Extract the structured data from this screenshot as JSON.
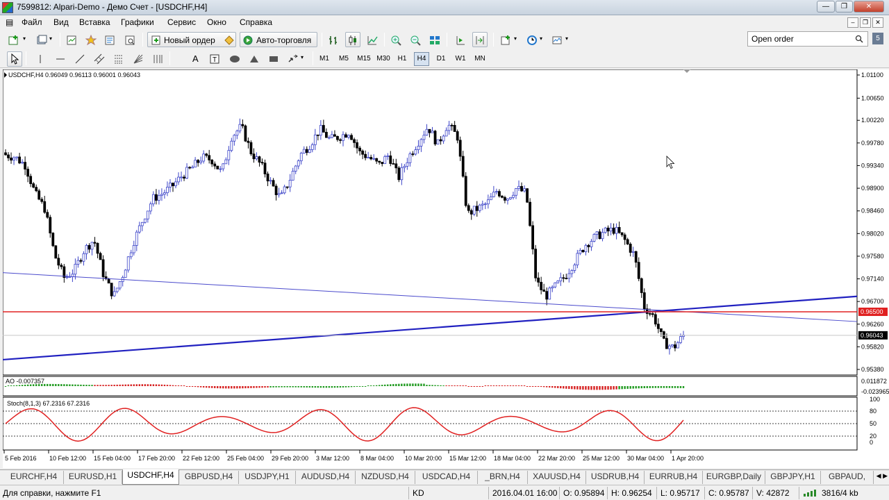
{
  "window": {
    "title": "7599812: Alpari-Demo - Демо Счет - [USDCHF,H4]",
    "min": "—",
    "max": "❐",
    "close": "✕"
  },
  "menu": [
    "Файл",
    "Вид",
    "Вставка",
    "Графики",
    "Сервис",
    "Окно",
    "Справка"
  ],
  "toolbar": {
    "new_order": "Новый ордер",
    "auto_trading": "Авто-торговля",
    "search_value": "Open order",
    "timeframes": [
      "M1",
      "M5",
      "M15",
      "M30",
      "H1",
      "H4",
      "D1",
      "W1",
      "MN"
    ],
    "active_timeframe": "H4"
  },
  "chart": {
    "symbol_info": "USDCHF,H4  0.96049 0.96113 0.96001 0.96043",
    "price_labels": [
      "1.01100",
      "1.00650",
      "1.00220",
      "0.99780",
      "0.99340",
      "0.98900",
      "0.98460",
      "0.98020",
      "0.97580",
      "0.97140",
      "0.96700",
      "0.96260",
      "0.95820",
      "0.95380"
    ],
    "level_red": "0.96500",
    "current_price": "0.96043",
    "ao_label": "AO -0.007357",
    "ao_scale_top": "0.011872",
    "ao_scale_bottom": "-0.023965",
    "stoch_label": "Stoch(8,1,3) 67.2316 67.2316",
    "stoch_levels": [
      "100",
      "80",
      "50",
      "20",
      "0"
    ],
    "time_labels": [
      "5 Feb 2016",
      "10 Feb 12:00",
      "15 Feb 04:00",
      "17 Feb 20:00",
      "22 Feb 12:00",
      "25 Feb 04:00",
      "29 Feb 20:00",
      "3 Mar 12:00",
      "8 Mar 04:00",
      "10 Mar 20:00",
      "15 Mar 12:00",
      "18 Mar 04:00",
      "22 Mar 20:00",
      "25 Mar 12:00",
      "30 Mar 04:00",
      "1 Apr 20:00"
    ],
    "colors": {
      "bull": "#3b43c8",
      "bear": "#000000",
      "resistance": "#e02020",
      "trend": "#2020c0",
      "stoch": "#e02020",
      "ao_up": "#1f9a1f",
      "ao_down": "#d62020"
    }
  },
  "chart_data": {
    "type": "candlestick",
    "symbol": "USDCHF",
    "timeframe": "H4",
    "ylim": [
      0.9538,
      1.011
    ],
    "close_series": [
      0.9955,
      0.995,
      0.9935,
      0.988,
      0.985,
      0.976,
      0.9715,
      0.973,
      0.977,
      0.979,
      0.972,
      0.968,
      0.9725,
      0.9785,
      0.983,
      0.987,
      0.988,
      0.9895,
      0.9915,
      0.993,
      0.995,
      0.9945,
      0.992,
      0.999,
      1.001,
      0.996,
      0.9935,
      0.99,
      0.987,
      0.991,
      0.9955,
      0.9975,
      1.0005,
      0.9985,
      0.999,
      1.0,
      0.996,
      0.995,
      0.9935,
      0.9955,
      0.991,
      0.995,
      0.998,
      1.001,
      0.9975,
      1.0015,
      0.999,
      0.984,
      0.985,
      0.986,
      0.9885,
      0.987,
      0.989,
      0.988,
      0.971,
      0.968,
      0.97,
      0.972,
      0.975,
      0.978,
      0.9795,
      0.9805,
      0.981,
      0.979,
      0.976,
      0.966,
      0.964,
      0.959,
      0.958,
      0.9604
    ],
    "levels": {
      "horizontal_red": 0.965,
      "current": 0.96043
    },
    "indicators": {
      "AO": {
        "value": -0.007357,
        "range": [
          -0.023965,
          0.011872
        ]
      },
      "Stoch": {
        "params": "8,1,3",
        "main": 67.2316,
        "signal": 67.2316,
        "levels": [
          20,
          50,
          80
        ]
      }
    }
  },
  "symbol_tabs": [
    "EURCHF,H4",
    "EURUSD,H1",
    "USDCHF,H4",
    "GBPUSD,H4",
    "USDJPY,H1",
    "AUDUSD,H4",
    "NZDUSD,H4",
    "USDCAD,H4",
    "_BRN,H4",
    "XAUUSD,H4",
    "USDRUB,H4",
    "EURRUB,H4",
    "EURGBP,Daily",
    "GBPJPY,H1",
    "GBPAUD,"
  ],
  "active_tab": "USDCHF,H4",
  "status": {
    "help": "Для справки, нажмите F1",
    "profile": "KD",
    "datetime": "2016.04.01 16:00",
    "open": "O: 0.95894",
    "high": "H: 0.96254",
    "low": "L: 0.95717",
    "close": "C: 0.95787",
    "volume": "V: 42872",
    "traffic": "3816/4 kb"
  }
}
